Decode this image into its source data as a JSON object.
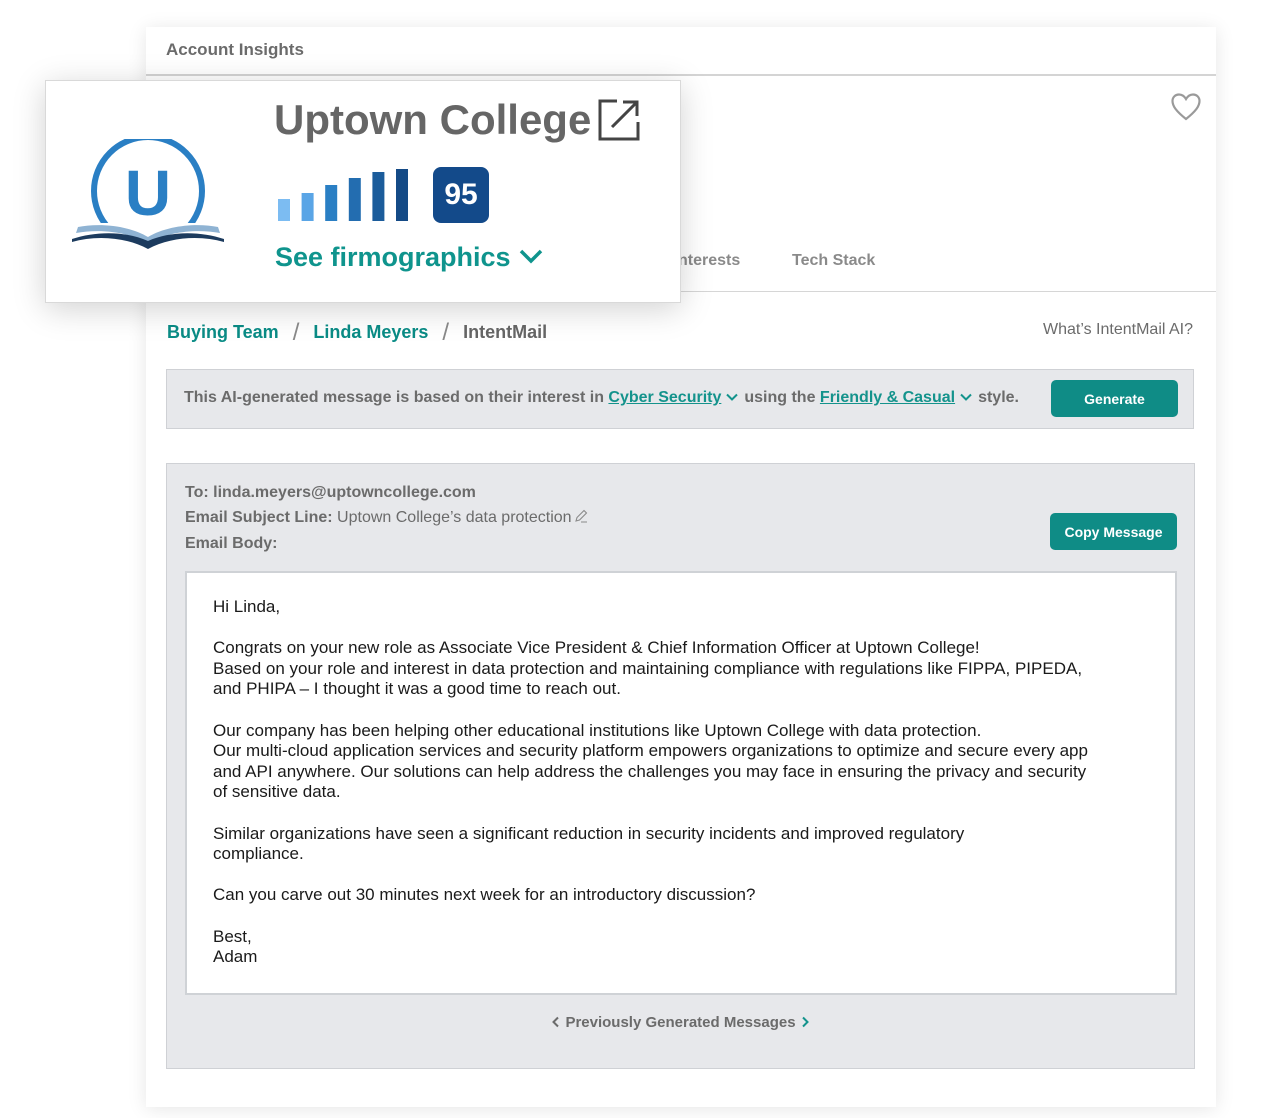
{
  "panel": {
    "title": "Account Insights",
    "tabs": [
      "nterests",
      "Tech Stack"
    ]
  },
  "company": {
    "name": "Uptown College",
    "score": "95",
    "intent_level": 6,
    "see_firmographics_label": "See firmographics",
    "logo_letter": "U",
    "colors": {
      "brand_blue": "#2a7fc4",
      "score_bg": "#134a8a",
      "accent_teal": "#0f948d"
    }
  },
  "breadcrumb": {
    "items": [
      "Buying Team",
      "Linda Meyers"
    ],
    "current": "IntentMail",
    "separator": "/"
  },
  "whats_link": "What’s IntentMail AI?",
  "generator": {
    "text_before": "This AI-generated message is based on their interest in",
    "interest": "Cyber Security",
    "text_middle": "using the",
    "style": "Friendly & Casual",
    "text_after": "style.",
    "button": "Generate"
  },
  "email": {
    "to": "To: linda.meyers@uptowncollege.com",
    "subject_label": "Email Subject Line:",
    "subject_value": "Uptown College’s data protection",
    "body_label": "Email Body:",
    "copy_button": "Copy Message",
    "body": {
      "greeting": "Hi Linda,",
      "p1": [
        "Congrats on your new role as Associate Vice President & Chief Information Officer at Uptown College!",
        "Based on your role and interest in data protection and maintaining compliance with regulations like FIPPA, PIPEDA,",
        "and PHIPA – I thought it was a good time to reach out."
      ],
      "p2": [
        "Our company has been helping other educational institutions like Uptown College with data protection.",
        "Our multi-cloud application services and security platform empowers organizations to optimize and secure every app",
        "and API anywhere. Our solutions can help address the challenges you may face in ensuring the privacy and security",
        "of sensitive data."
      ],
      "p3": [
        "Similar organizations have seen a significant reduction in security incidents and improved regulatory",
        "compliance."
      ],
      "p4": "Can you carve out 30 minutes next week for an introductory discussion?",
      "signoff": [
        "Best,",
        "Adam"
      ]
    },
    "prev_label": "Previously Generated Messages"
  }
}
